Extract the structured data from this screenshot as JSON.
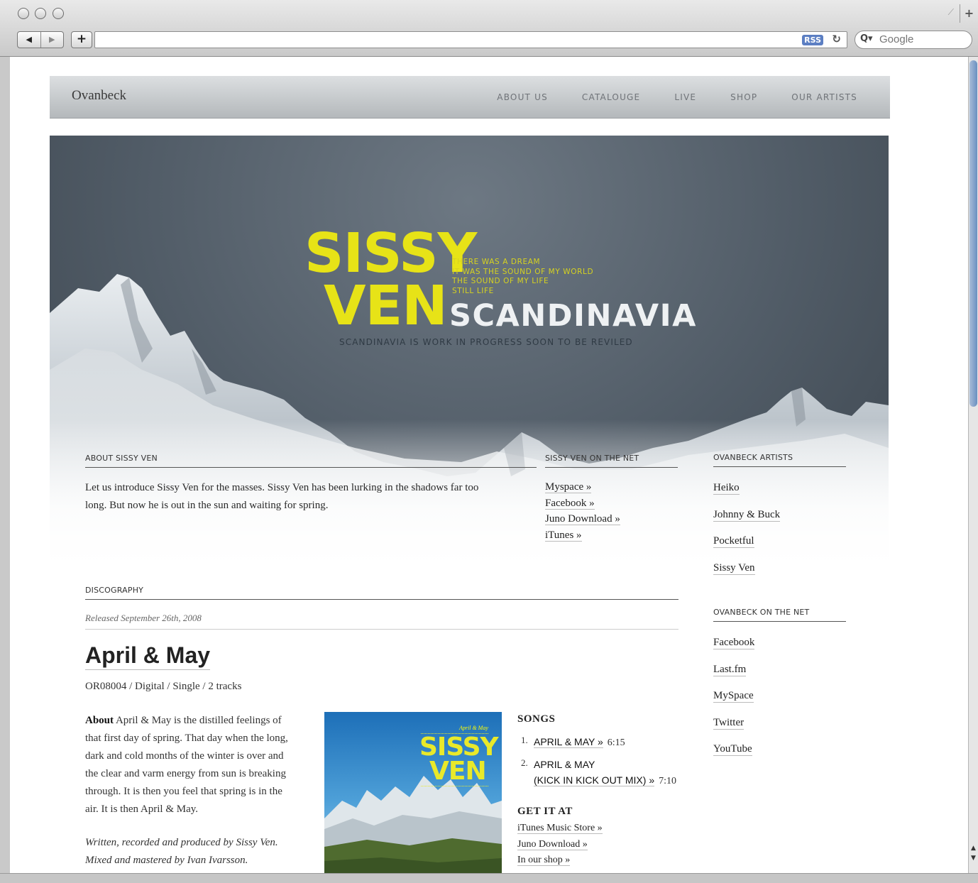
{
  "browser": {
    "search_placeholder": "Google",
    "rss_label": "RSS",
    "back_glyph": "◀",
    "forward_glyph": "▶",
    "add_glyph": "+",
    "reload_glyph": "↻",
    "search_icon": "Q▾",
    "new_tab_glyph": "+"
  },
  "site": {
    "logo": "Ovanbeck",
    "nav": [
      "ABOUT US",
      "CATALOUGE",
      "LIVE",
      "SHOP",
      "OUR ARTISTS"
    ]
  },
  "hero": {
    "line1": "SISSY",
    "line2": "VEN",
    "poem": [
      "THERE WAS A DREAM",
      "IT WAS THE SOUND OF MY WORLD",
      "THE SOUND OF MY LIFE",
      "STILL LIFE"
    ],
    "subtitle": "SCANDINAVIA",
    "tagline": "SCANDINAVIA IS WORK IN PROGRESS SOON TO BE REVILED"
  },
  "about": {
    "heading": "ABOUT SISSY VEN",
    "text_line1": "Let us introduce Sissy Ven for the masses. Sissy Ven has been lurking in the shadows far too",
    "text_line2": "long. But now he is out in the sun and waiting for spring."
  },
  "net": {
    "heading": "SISSY VEN ON THE NET",
    "links": [
      "Myspace »",
      "Facebook »",
      "Juno Download »",
      "iTunes »"
    ]
  },
  "artists": {
    "heading": "OVANBECK ARTISTS",
    "items": [
      "Heiko",
      "Johnny & Buck",
      "Pocketful",
      "Sissy Ven"
    ]
  },
  "ovanbeck_net": {
    "heading": "OVANBECK ON THE NET",
    "items": [
      "Facebook",
      "Last.fm",
      "MySpace",
      "Twitter",
      "YouTube"
    ]
  },
  "discography": {
    "heading": "DISCOGRAPHY",
    "released": "Released September 26th, 2008",
    "title": "April & May",
    "meta": "OR08004 / Digital / Single / 2 tracks",
    "about_label": "About",
    "about_lines": [
      " April & May is the distilled feelings of",
      "that first day of spring. That day when the long,",
      "dark and cold months of the winter is over and",
      "the clear and varm energy from sun is breaking",
      "through. It is then you feel that spring is in the",
      "air. It is then April & May."
    ],
    "credits_line1": "Written, recorded and produced by Sissy Ven.",
    "credits_line2": "Mixed and mastered by Ivan Ivarsson.",
    "cover": {
      "small_text": "April & May",
      "line1": "SISSY",
      "line2": "VEN"
    },
    "songs_heading": "SONGS",
    "songs": [
      {
        "num": "1.",
        "name": "APRIL & MAY »",
        "name2": "",
        "duration": "6:15"
      },
      {
        "num": "2.",
        "name": "APRIL & MAY",
        "name2": "(KICK IN KICK OUT MIX) »",
        "duration": "7:10"
      }
    ],
    "getit_heading": "GET IT AT",
    "getit": [
      "iTunes Music Store »",
      "Juno Download »",
      "In our shop »"
    ]
  },
  "colors": {
    "accent_yellow": "#e7e317",
    "header_gray": "#c8cbce"
  }
}
